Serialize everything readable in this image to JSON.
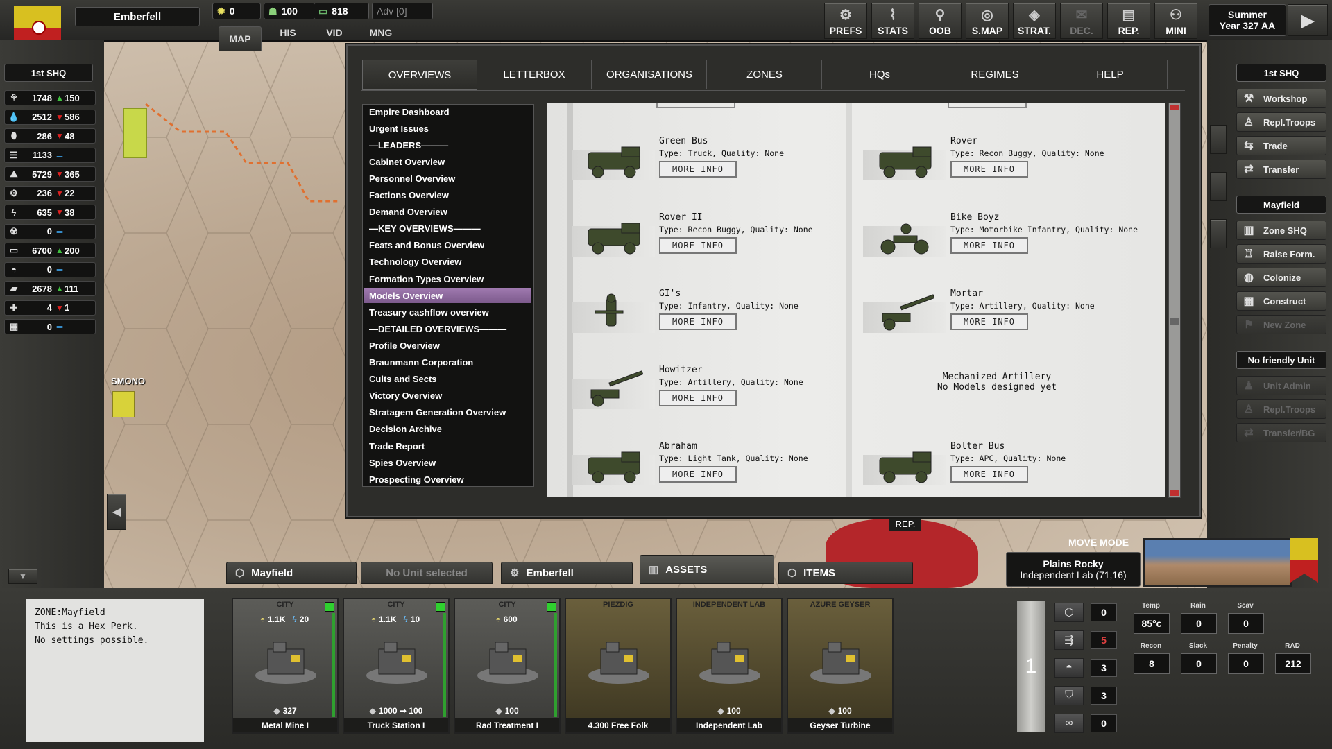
{
  "topbar": {
    "region_name": "Emberfell",
    "res1": "0",
    "res2": "100",
    "res3": "818",
    "adv": "Adv [0]",
    "tabs": [
      "MAP",
      "HIS",
      "VID",
      "MNG"
    ],
    "buttons": [
      {
        "label": "PREFS",
        "icon": "gear-icon"
      },
      {
        "label": "STATS",
        "icon": "chart-icon"
      },
      {
        "label": "OOB",
        "icon": "org-icon"
      },
      {
        "label": "S.MAP",
        "icon": "globe-icon"
      },
      {
        "label": "STRAT.",
        "icon": "strat-icon"
      },
      {
        "label": "DEC.",
        "icon": "mail-icon"
      },
      {
        "label": "REP.",
        "icon": "report-icon"
      },
      {
        "label": "MINI",
        "icon": "person-icon"
      }
    ],
    "season": "Summer",
    "year": "Year 327 AA"
  },
  "left": {
    "hq_label": "1st SHQ",
    "resources": [
      {
        "value": "1748",
        "trend": "up",
        "delta": "150",
        "icon": "food-icon"
      },
      {
        "value": "2512",
        "trend": "down",
        "delta": "586",
        "icon": "water-icon"
      },
      {
        "value": "286",
        "trend": "down",
        "delta": "48",
        "icon": "oil-icon"
      },
      {
        "value": "1133",
        "trend": "eq",
        "delta": "",
        "icon": "metal-icon"
      },
      {
        "value": "5729",
        "trend": "down",
        "delta": "365",
        "icon": "ore-icon"
      },
      {
        "value": "236",
        "trend": "down",
        "delta": "22",
        "icon": "gear-icon"
      },
      {
        "value": "635",
        "trend": "down",
        "delta": "38",
        "icon": "energy-icon"
      },
      {
        "value": "0",
        "trend": "eq",
        "delta": "",
        "icon": "radiation-icon"
      },
      {
        "value": "6700",
        "trend": "up",
        "delta": "200",
        "icon": "money-icon"
      },
      {
        "value": "0",
        "trend": "eq",
        "delta": "",
        "icon": "helmet-icon"
      },
      {
        "value": "2678",
        "trend": "up",
        "delta": "111",
        "icon": "brick-icon"
      },
      {
        "value": "4",
        "trend": "down",
        "delta": "1",
        "icon": "medical-icon"
      },
      {
        "value": "0",
        "trend": "eq",
        "delta": "",
        "icon": "building-icon"
      }
    ]
  },
  "map": {
    "labels": [
      "SMONO"
    ],
    "rep_label": "REP."
  },
  "dialog": {
    "tabs": [
      "OVERVIEWS",
      "LETTERBOX",
      "ORGANISATIONS",
      "ZONES",
      "HQs",
      "REGIMES",
      "HELP"
    ],
    "nav": [
      "Empire Dashboard",
      "Urgent Issues",
      "—LEADERS———",
      "Cabinet Overview",
      "Personnel Overview",
      "Factions Overview",
      "Demand Overview",
      "—KEY OVERVIEWS———",
      "Feats and Bonus Overview",
      "Technology Overview",
      "Formation Types Overview",
      "Models Overview",
      "Treasury cashflow overview",
      "—DETAILED OVERVIEWS———",
      "Profile Overview",
      "Braunmann Corporation",
      "Cults and Sects",
      "Victory Overview",
      "Stratagem Generation Overview",
      "Decision Archive",
      "Trade Report",
      "Spies Overview",
      "Prospecting Overview"
    ],
    "selected_nav": "Models Overview",
    "more_info": "MORE INFO",
    "models": [
      {
        "name": "Green Bus",
        "type": "Type: Truck, Quality: None"
      },
      {
        "name": "Rover",
        "type": "Type: Recon Buggy, Quality: None"
      },
      {
        "name": "Rover II",
        "type": "Type: Recon Buggy, Quality: None"
      },
      {
        "name": "Bike Boyz",
        "type": "Type: Motorbike Infantry, Quality: None"
      },
      {
        "name": "GI's",
        "type": "Type: Infantry, Quality: None"
      },
      {
        "name": "Mortar",
        "type": "Type: Artillery, Quality: None"
      },
      {
        "name": "Howitzer",
        "type": "Type: Artillery, Quality: None"
      },
      {
        "name": "Abraham",
        "type": "Type: Light Tank, Quality: None"
      },
      {
        "name": "Bolter Bus",
        "type": "Type: APC, Quality: None"
      }
    ],
    "empty_model": {
      "title": "Mechanized Artillery",
      "subtitle": "No Models designed yet"
    }
  },
  "right": {
    "hq_label": "1st SHQ",
    "hq_buttons": [
      "Workshop",
      "Repl.Troops",
      "Trade",
      "Transfer"
    ],
    "zone_label": "Mayfield",
    "zone_buttons": [
      "Zone SHQ",
      "Raise Form.",
      "Colonize",
      "Construct"
    ],
    "zone_disabled": [
      "New Zone"
    ],
    "unit_label": "No friendly Unit",
    "unit_buttons": [
      "Unit Admin",
      "Repl.Troops",
      "Transfer/BG"
    ]
  },
  "bottom": {
    "tabs": [
      {
        "label": "Mayfield",
        "state": "normal"
      },
      {
        "label": "No Unit selected",
        "state": "dim"
      },
      {
        "label": "Emberfell",
        "state": "normal"
      },
      {
        "label": "ASSETS",
        "state": "active"
      },
      {
        "label": "ITEMS",
        "state": "normal"
      }
    ],
    "move_mode": "MOVE MODE",
    "terrain": "Plains Rocky",
    "terrain_sub": "Independent Lab (71,16)",
    "zone_text": "ZONE:Mayfield\nThis is a Hex Perk.\nNo settings possible.",
    "assets": [
      {
        "type": "CITY",
        "name": "Metal Mine I",
        "top1": "1.1K",
        "top2": "20",
        "bottom": "327",
        "color": "grey"
      },
      {
        "type": "CITY",
        "name": "Truck Station I",
        "top1": "1.1K",
        "top2": "10",
        "bottom": "1000 ➞ 100",
        "color": "grey"
      },
      {
        "type": "CITY",
        "name": "Rad Treatment I",
        "top1": "600",
        "top2": "",
        "bottom": "100",
        "color": "grey"
      },
      {
        "type": "PIEZDIG",
        "name": "4.300 Free Folk",
        "top1": "",
        "top2": "",
        "bottom": "",
        "color": "olive"
      },
      {
        "type": "INDEPENDENT LAB",
        "name": "Independent Lab",
        "top1": "",
        "top2": "",
        "bottom": "100",
        "color": "olive"
      },
      {
        "type": "AZURE GEYSER",
        "name": "Geyser Turbine",
        "top1": "",
        "top2": "",
        "bottom": "100",
        "color": "olive"
      }
    ],
    "big_number": "1",
    "counters": [
      "0",
      "5",
      "3",
      "3",
      "0"
    ],
    "stats": [
      {
        "label": "Temp",
        "value": "85°c"
      },
      {
        "label": "Rain",
        "value": "0"
      },
      {
        "label": "Scav",
        "value": "0"
      },
      {
        "label": "Recon",
        "value": "8"
      },
      {
        "label": "Slack",
        "value": "0"
      },
      {
        "label": "Penalty",
        "value": "0"
      },
      {
        "label": "RAD",
        "value": "212"
      }
    ]
  }
}
